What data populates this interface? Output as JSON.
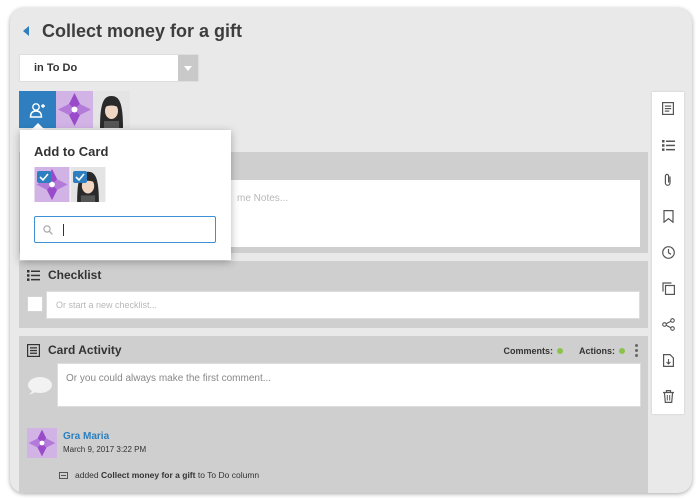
{
  "card": {
    "title": "Collect money for a gift"
  },
  "list_select": {
    "label": "in To Do"
  },
  "notes": {
    "placeholder": "me Notes..."
  },
  "checklist": {
    "title": "Checklist",
    "input_placeholder": "Or start a new checklist..."
  },
  "activity": {
    "title": "Card Activity",
    "comments_label": "Comments:",
    "actions_label": "Actions:",
    "comment_placeholder": "Or you could always make the first comment...",
    "entry": {
      "user": "Gra Maria",
      "date": "March 9, 2017 3:22 PM",
      "action_prefix": "added",
      "action_card": "Collect money for a gift",
      "action_suffix": "to To Do column"
    }
  },
  "popover": {
    "title": "Add to Card",
    "search_value": ""
  },
  "colors": {
    "accent": "#2f7fc0",
    "status_dot": "#8bc34a",
    "link": "#2a7fbf"
  },
  "toolbar": [
    "notes-icon",
    "checklist-icon",
    "attachment-icon",
    "bookmark-icon",
    "clock-icon",
    "copy-icon",
    "share-icon",
    "export-icon",
    "trash-icon"
  ]
}
